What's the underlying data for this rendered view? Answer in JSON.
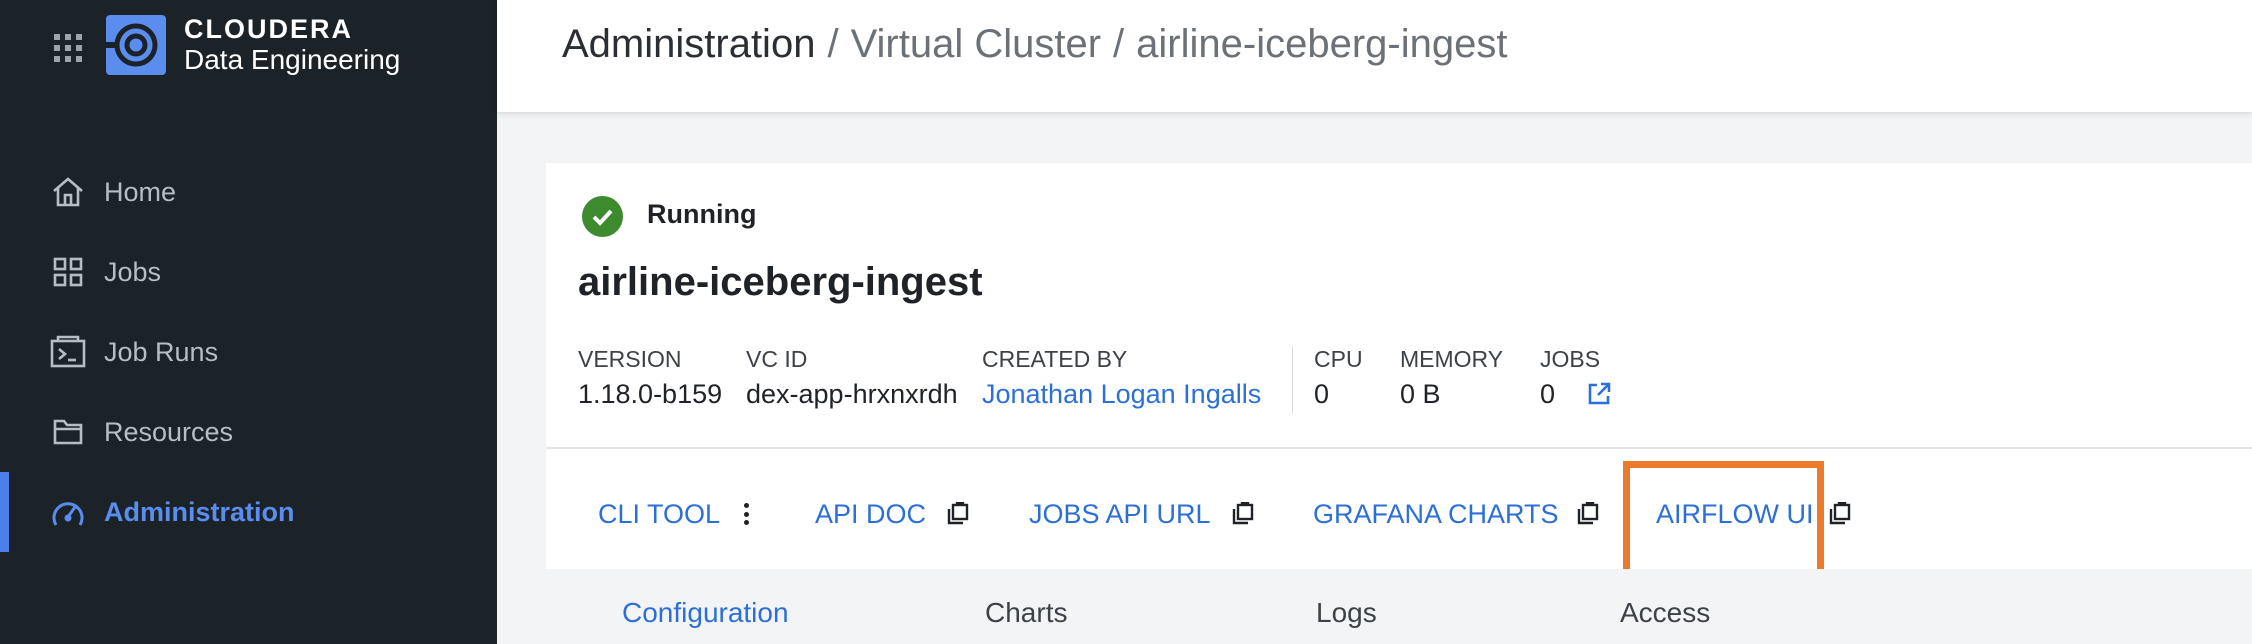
{
  "brand": {
    "line1": "CLOUDERA",
    "line2": "Data Engineering"
  },
  "sidebar": {
    "items": [
      {
        "label": "Home",
        "icon": "home-icon",
        "active": false
      },
      {
        "label": "Jobs",
        "icon": "grid-icon",
        "active": false
      },
      {
        "label": "Job Runs",
        "icon": "terminal-icon",
        "active": false
      },
      {
        "label": "Resources",
        "icon": "folder-icon",
        "active": false
      },
      {
        "label": "Administration",
        "icon": "speedometer-icon",
        "active": true
      }
    ]
  },
  "header": {
    "breadcrumb": [
      "Administration",
      "Virtual Cluster",
      "airline-iceberg-ingest"
    ],
    "separator": "/"
  },
  "cluster": {
    "status": "Running",
    "name": "airline-iceberg-ingest",
    "meta": {
      "version_label": "VERSION",
      "version": "1.18.0-b159",
      "vcid_label": "VC ID",
      "vcid": "dex-app-hrxnxrdh",
      "created_label": "CREATED BY",
      "created_by": "Jonathan Logan Ingalls",
      "cpu_label": "CPU",
      "cpu": "0",
      "memory_label": "MEMORY",
      "memory": "0 B",
      "jobs_label": "JOBS",
      "jobs": "0"
    }
  },
  "actions": {
    "cli_tool": "CLI TOOL",
    "api_doc": "API DOC",
    "jobs_api_url": "JOBS API URL",
    "grafana_charts": "GRAFANA CHARTS",
    "airflow_ui": "AIRFLOW UI"
  },
  "tabs": [
    "Configuration",
    "Charts",
    "Logs",
    "Access"
  ],
  "colors": {
    "sidebar_bg": "#1b2329",
    "accent": "#2c6fd6",
    "status_ok": "#3d8a2f",
    "highlight": "#ea7a2c"
  }
}
